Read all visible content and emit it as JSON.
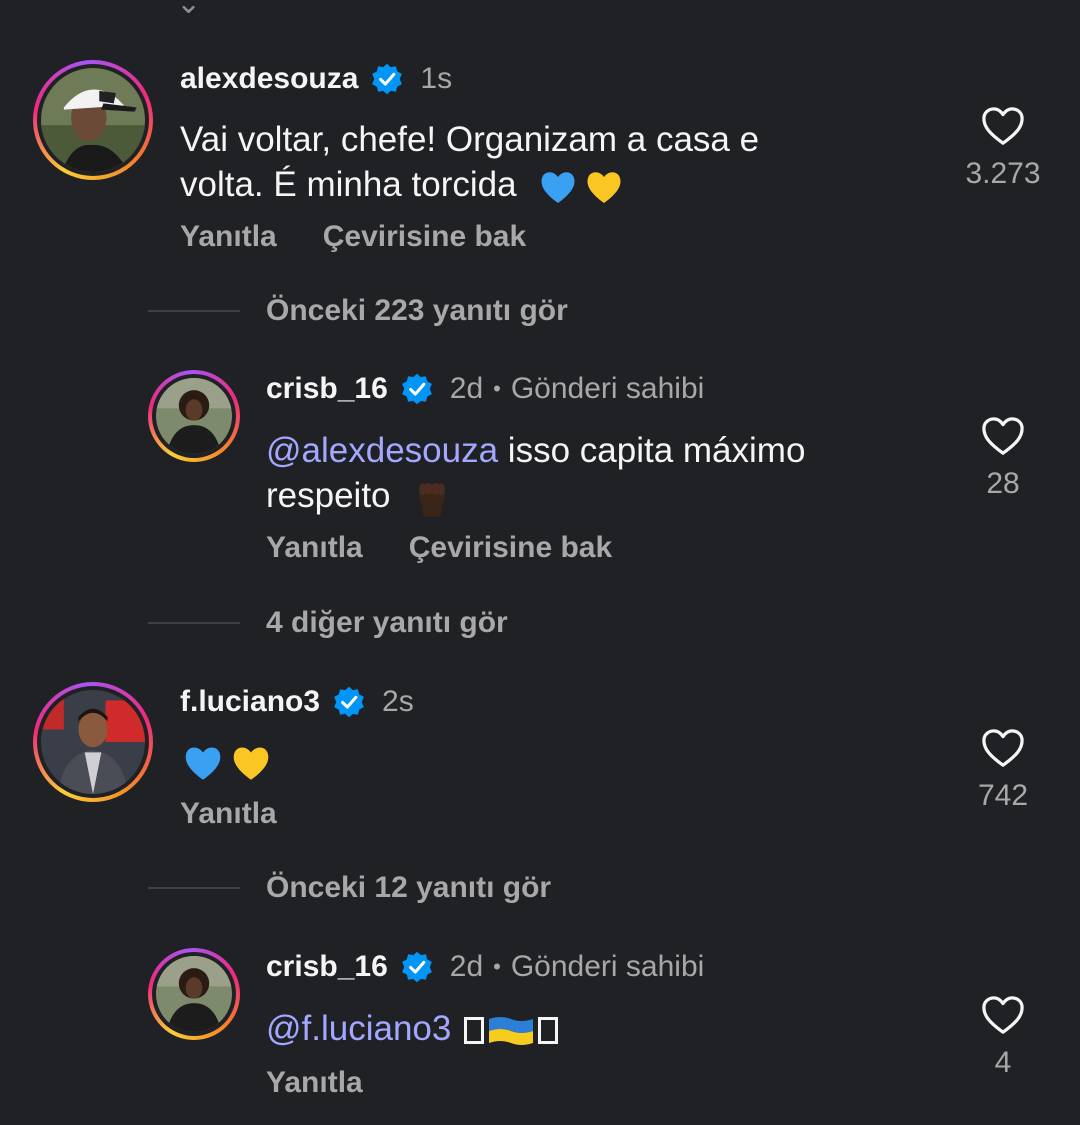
{
  "colors": {
    "background": "#202125",
    "text_primary": "#f5f5f5",
    "text_secondary": "#a8a8a8",
    "mention": "#a3a7ff",
    "verified": "#0095f6"
  },
  "comments": [
    {
      "username": "alexdesouza",
      "verified": true,
      "time": "1s",
      "text_line1": "Vai voltar, chefe! Organizam a casa e",
      "text_line2": "volta. É minha torcida",
      "emojis": [
        "blue-heart",
        "yellow-heart"
      ],
      "reply_label": "Yanıtla",
      "translate_label": "Çevirisine bak",
      "like_count": "3.273",
      "like_icon": "heart-outline-icon"
    },
    {
      "view_replies": "Önceki 223 yanıtı gör"
    },
    {
      "username": "crisb_16",
      "verified": true,
      "time": "2d",
      "separator": "•",
      "owner_label": "Gönderi sahibi",
      "mention": "@alexdesouza",
      "text_line1": " isso capita máximo",
      "text_line2": "respeito",
      "emojis": [
        "raised-fist-dark"
      ],
      "reply_label": "Yanıtla",
      "translate_label": "Çevirisine bak",
      "like_count": "28",
      "like_icon": "heart-outline-icon"
    },
    {
      "view_replies": "4 diğer yanıtı gör"
    },
    {
      "username": "f.luciano3",
      "verified": true,
      "time": "2s",
      "emojis": [
        "blue-heart",
        "yellow-heart"
      ],
      "reply_label": "Yanıtla",
      "like_count": "742",
      "like_icon": "heart-outline-icon"
    },
    {
      "view_replies": "Önceki 12 yanıtı gör"
    },
    {
      "username": "crisb_16",
      "verified": true,
      "time": "2d",
      "separator": "•",
      "owner_label": "Gönderi sahibi",
      "mention": "@f.luciano3",
      "emojis": [
        "unsupported-glyph",
        "ukraine-flag",
        "unsupported-glyph"
      ],
      "reply_label": "Yanıtla",
      "like_count": "4",
      "like_icon": "heart-outline-icon"
    }
  ]
}
